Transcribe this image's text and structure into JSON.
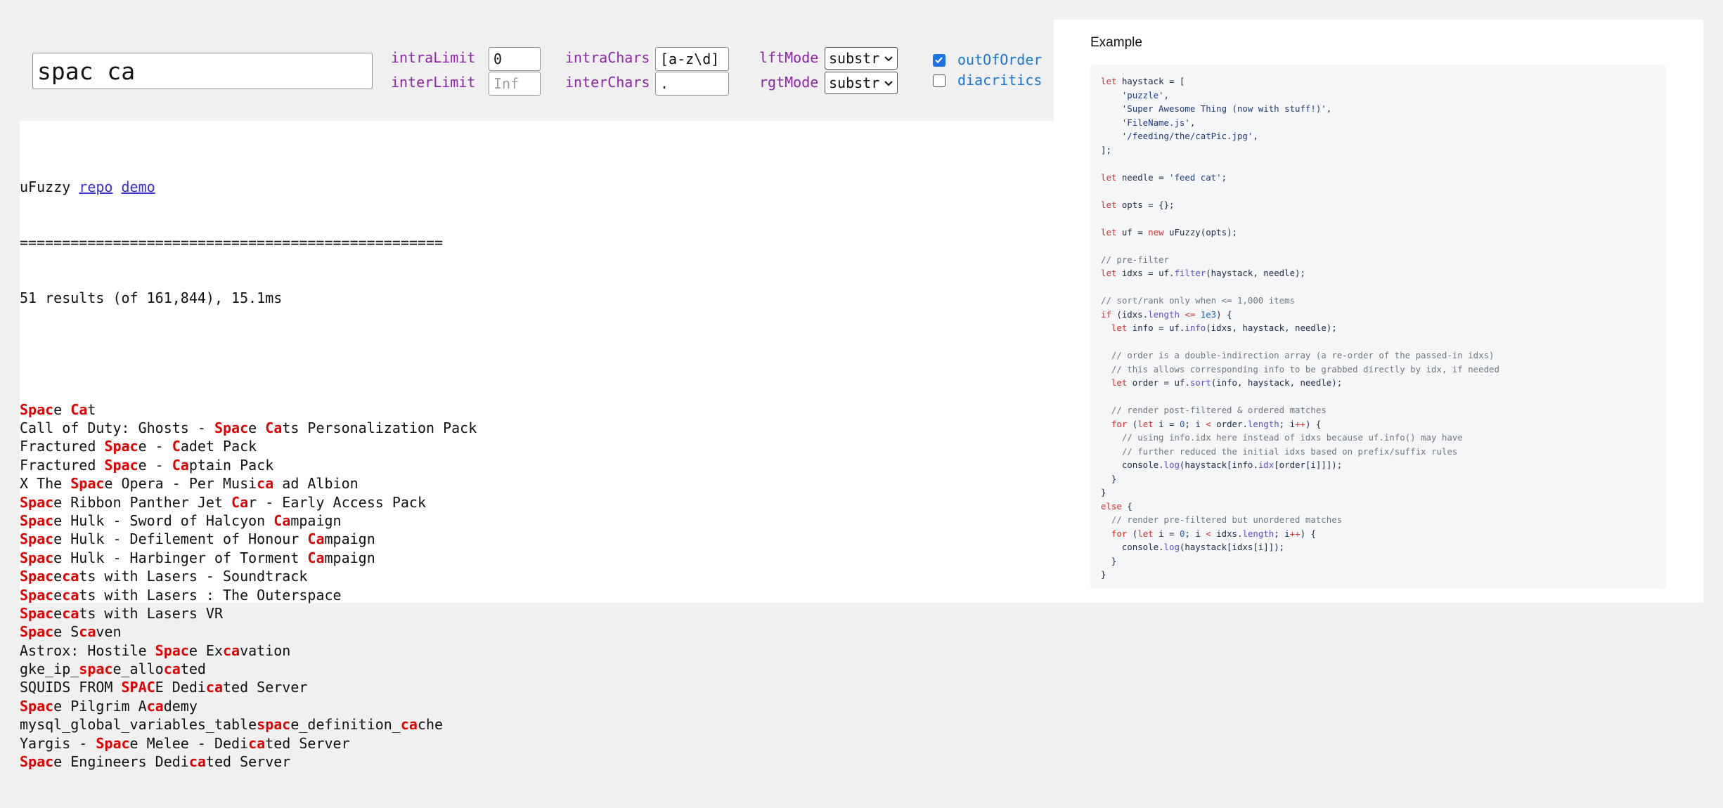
{
  "search": {
    "value": "spac ca"
  },
  "controls": {
    "intraLimit": {
      "label": "intraLimit",
      "value": "0"
    },
    "interLimit": {
      "label": "interLimit",
      "value": "",
      "placeholder": "Inf"
    },
    "intraChars": {
      "label": "intraChars",
      "value": "[a-z\\d]"
    },
    "interChars": {
      "label": "interChars",
      "value": "."
    },
    "lftMode": {
      "label": "lftMode",
      "value": "substr"
    },
    "rgtMode": {
      "label": "rgtMode",
      "value": "substr"
    },
    "outOfOrder": {
      "label": "outOfOrder",
      "checked": true
    },
    "diacritics": {
      "label": "diacritics",
      "checked": false
    }
  },
  "header": {
    "title": "uFuzzy",
    "links": [
      "repo",
      "demo"
    ],
    "divider": "==================================================",
    "summary": "51 results (of 161,844), 15.1ms"
  },
  "results": [
    [
      [
        "Spac",
        1
      ],
      [
        "e ",
        0
      ],
      [
        "Ca",
        1
      ],
      [
        "t",
        0
      ]
    ],
    [
      [
        "Call of Duty: Ghosts - ",
        0
      ],
      [
        "Spac",
        1
      ],
      [
        "e ",
        0
      ],
      [
        "Ca",
        1
      ],
      [
        "ts Personalization Pack",
        0
      ]
    ],
    [
      [
        "Fractured ",
        0
      ],
      [
        "Spac",
        1
      ],
      [
        "e - ",
        0
      ],
      [
        "C",
        1
      ],
      [
        "a",
        0
      ],
      [
        "det Pack",
        0
      ]
    ],
    [
      [
        "Fractured ",
        0
      ],
      [
        "Spac",
        1
      ],
      [
        "e - ",
        0
      ],
      [
        "Ca",
        1
      ],
      [
        "ptain Pack",
        0
      ]
    ],
    [
      [
        "X The ",
        0
      ],
      [
        "Spac",
        1
      ],
      [
        "e Opera - Per Musi",
        0
      ],
      [
        "ca",
        1
      ],
      [
        " ad Albion",
        0
      ]
    ],
    [
      [
        "Spac",
        1
      ],
      [
        "e Ribbon Panther Jet ",
        0
      ],
      [
        "Ca",
        1
      ],
      [
        "r - Early Access Pack",
        0
      ]
    ],
    [
      [
        "Spac",
        1
      ],
      [
        "e Hulk - Sword of Halcyon ",
        0
      ],
      [
        "Ca",
        1
      ],
      [
        "mpaign",
        0
      ]
    ],
    [
      [
        "Spac",
        1
      ],
      [
        "e Hulk - Defilement of Honour ",
        0
      ],
      [
        "Ca",
        1
      ],
      [
        "mpaign",
        0
      ]
    ],
    [
      [
        "Spac",
        1
      ],
      [
        "e Hulk - Harbinger of Torment ",
        0
      ],
      [
        "Ca",
        1
      ],
      [
        "mpaign",
        0
      ]
    ],
    [
      [
        "Spac",
        1
      ],
      [
        "e",
        0
      ],
      [
        "ca",
        1
      ],
      [
        "ts with Lasers - Soundtrack",
        0
      ]
    ],
    [
      [
        "Spac",
        1
      ],
      [
        "e",
        0
      ],
      [
        "ca",
        1
      ],
      [
        "ts with Lasers : The Outerspace",
        0
      ]
    ],
    [
      [
        "Spac",
        1
      ],
      [
        "e",
        0
      ],
      [
        "ca",
        1
      ],
      [
        "ts with Lasers VR",
        0
      ]
    ],
    [
      [
        "Spac",
        1
      ],
      [
        "e S",
        0
      ],
      [
        "ca",
        1
      ],
      [
        "ven",
        0
      ]
    ],
    [
      [
        "Astrox: Hostile ",
        0
      ],
      [
        "Spac",
        1
      ],
      [
        "e Ex",
        0
      ],
      [
        "ca",
        1
      ],
      [
        "vation",
        0
      ]
    ],
    [
      [
        "gke_ip_",
        0
      ],
      [
        "spac",
        1
      ],
      [
        "e_allo",
        0
      ],
      [
        "ca",
        1
      ],
      [
        "ted",
        0
      ]
    ],
    [
      [
        "SQUIDS FROM ",
        0
      ],
      [
        "SPAC",
        1
      ],
      [
        "E Dedi",
        0
      ],
      [
        "ca",
        1
      ],
      [
        "ted Server",
        0
      ]
    ],
    [
      [
        "Spac",
        1
      ],
      [
        "e Pilgrim A",
        0
      ],
      [
        "ca",
        1
      ],
      [
        "demy",
        0
      ]
    ],
    [
      [
        "mysql_global_variables_table",
        0
      ],
      [
        "spac",
        1
      ],
      [
        "e_definition_",
        0
      ],
      [
        "ca",
        1
      ],
      [
        "che",
        0
      ]
    ],
    [
      [
        "Yargis - ",
        0
      ],
      [
        "Spac",
        1
      ],
      [
        "e Melee - Dedi",
        0
      ],
      [
        "ca",
        1
      ],
      [
        "ted Server",
        0
      ]
    ],
    [
      [
        "Spac",
        1
      ],
      [
        "e Engineers Dedi",
        0
      ],
      [
        "ca",
        1
      ],
      [
        "ted Server",
        0
      ]
    ]
  ],
  "example": {
    "title": "Example",
    "code": [
      [
        [
          "let",
          "kw"
        ],
        [
          " haystack = ["
        ]
      ],
      [
        [
          "    "
        ],
        [
          "'puzzle'",
          "str"
        ],
        [
          ","
        ]
      ],
      [
        [
          "    "
        ],
        [
          "'Super Awesome Thing (now with stuff!)'",
          "str"
        ],
        [
          ","
        ]
      ],
      [
        [
          "    "
        ],
        [
          "'FileName.js'",
          "str"
        ],
        [
          ","
        ]
      ],
      [
        [
          "    "
        ],
        [
          "'/feeding/the/catPic.jpg'",
          "str"
        ],
        [
          ","
        ]
      ],
      [
        [
          "];"
        ]
      ],
      [
        [
          ""
        ]
      ],
      [
        [
          "let",
          "kw"
        ],
        [
          " needle = "
        ],
        [
          "'feed cat'",
          "str"
        ],
        [
          ";"
        ]
      ],
      [
        [
          ""
        ]
      ],
      [
        [
          "let",
          "kw"
        ],
        [
          " opts = {};"
        ]
      ],
      [
        [
          ""
        ]
      ],
      [
        [
          "let",
          "kw"
        ],
        [
          " uf = "
        ],
        [
          "new",
          "kw"
        ],
        [
          " uFuzzy(opts);"
        ]
      ],
      [
        [
          ""
        ]
      ],
      [
        [
          "// pre-filter",
          "cm"
        ]
      ],
      [
        [
          "let",
          "kw"
        ],
        [
          " idxs = uf."
        ],
        [
          "filter",
          "fn"
        ],
        [
          "(haystack, needle);"
        ]
      ],
      [
        [
          ""
        ]
      ],
      [
        [
          "// sort/rank only when <= 1,000 items",
          "cm"
        ]
      ],
      [
        [
          "if",
          "kw"
        ],
        [
          " (idxs."
        ],
        [
          "length",
          "fn"
        ],
        [
          " <= ",
          "kw"
        ],
        [
          "1e3",
          "num"
        ],
        [
          ") {"
        ]
      ],
      [
        [
          "  "
        ],
        [
          "let",
          "kw"
        ],
        [
          " info = uf."
        ],
        [
          "info",
          "fn"
        ],
        [
          "(idxs, haystack, needle);"
        ]
      ],
      [
        [
          ""
        ]
      ],
      [
        [
          "  // order is a double-indirection array (a re-order of the passed-in idxs)",
          "cm"
        ]
      ],
      [
        [
          "  // this allows corresponding info to be grabbed directly by idx, if needed",
          "cm"
        ]
      ],
      [
        [
          "  "
        ],
        [
          "let",
          "kw"
        ],
        [
          " order = uf."
        ],
        [
          "sort",
          "fn"
        ],
        [
          "(info, haystack, needle);"
        ]
      ],
      [
        [
          ""
        ]
      ],
      [
        [
          "  // render post-filtered & ordered matches",
          "cm"
        ]
      ],
      [
        [
          "  "
        ],
        [
          "for",
          "kw"
        ],
        [
          " ("
        ],
        [
          "let",
          "kw"
        ],
        [
          " i = "
        ],
        [
          "0",
          "num"
        ],
        [
          "; i "
        ],
        [
          "<",
          "kw"
        ],
        [
          " order."
        ],
        [
          "length",
          "fn"
        ],
        [
          "; i"
        ],
        [
          "++",
          "kw"
        ],
        [
          ") {"
        ]
      ],
      [
        [
          "    // using info.idx here instead of idxs because uf.info() may have",
          "cm"
        ]
      ],
      [
        [
          "    // further reduced the initial idxs based on prefix/suffix rules",
          "cm"
        ]
      ],
      [
        [
          "    console."
        ],
        [
          "log",
          "fn"
        ],
        [
          "(haystack[info."
        ],
        [
          "idx",
          "fn"
        ],
        [
          "[order[i]]]);"
        ]
      ],
      [
        [
          "  }"
        ]
      ],
      [
        [
          "}"
        ]
      ],
      [
        [
          "else",
          "kw"
        ],
        [
          " {"
        ]
      ],
      [
        [
          "  // render pre-filtered but unordered matches",
          "cm"
        ]
      ],
      [
        [
          "  "
        ],
        [
          "for",
          "kw"
        ],
        [
          " ("
        ],
        [
          "let",
          "kw"
        ],
        [
          " i = "
        ],
        [
          "0",
          "num"
        ],
        [
          "; i "
        ],
        [
          "<",
          "kw"
        ],
        [
          " idxs."
        ],
        [
          "length",
          "fn"
        ],
        [
          "; i"
        ],
        [
          "++",
          "kw"
        ],
        [
          ") {"
        ]
      ],
      [
        [
          "    console."
        ],
        [
          "log",
          "fn"
        ],
        [
          "(haystack[idxs[i]]);"
        ]
      ],
      [
        [
          "  }"
        ]
      ],
      [
        [
          "}"
        ]
      ]
    ]
  },
  "colors": {
    "highlight": "#e00000",
    "label_purple": "#8e24aa",
    "label_blue": "#1976d2",
    "checkbox_blue": "#1a73e8"
  },
  "icons": [
    "chevron-down-icon",
    "checkmark-icon"
  ]
}
